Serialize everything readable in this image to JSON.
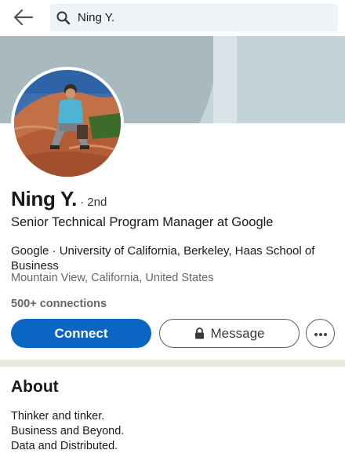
{
  "search": {
    "query": "Ning Y."
  },
  "profile": {
    "name": "Ning Y.",
    "degree": "· 2nd",
    "headline": "Senior Technical Program Manager at Google",
    "education": "Google · University of California, Berkeley, Haas School of Business",
    "location": "Mountain View, California, United States",
    "connections": "500+ connections"
  },
  "actions": {
    "connect_label": "Connect",
    "message_label": "Message",
    "more_icon": "ellipsis-icon"
  },
  "about": {
    "title": "About",
    "lines": [
      "Thinker and tinker.",
      "Business and Beyond.",
      "Data and Distributed."
    ]
  },
  "colors": {
    "accent": "#0a66c2",
    "banner": "#c6d5da",
    "search_bg": "#eef3f8"
  }
}
